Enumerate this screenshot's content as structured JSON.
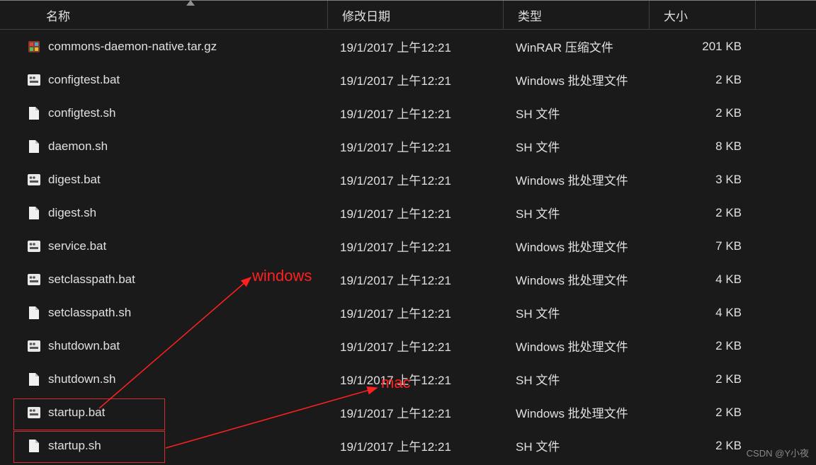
{
  "columns": {
    "name": "名称",
    "date": "修改日期",
    "type": "类型",
    "size": "大小"
  },
  "files": [
    {
      "name": "commons-daemon-native.tar.gz",
      "date": "19/1/2017 上午12:21",
      "type": "WinRAR 压缩文件",
      "size": "201 KB",
      "icon": "archive"
    },
    {
      "name": "configtest.bat",
      "date": "19/1/2017 上午12:21",
      "type": "Windows 批处理文件",
      "size": "2 KB",
      "icon": "bat"
    },
    {
      "name": "configtest.sh",
      "date": "19/1/2017 上午12:21",
      "type": "SH 文件",
      "size": "2 KB",
      "icon": "file"
    },
    {
      "name": "daemon.sh",
      "date": "19/1/2017 上午12:21",
      "type": "SH 文件",
      "size": "8 KB",
      "icon": "file"
    },
    {
      "name": "digest.bat",
      "date": "19/1/2017 上午12:21",
      "type": "Windows 批处理文件",
      "size": "3 KB",
      "icon": "bat"
    },
    {
      "name": "digest.sh",
      "date": "19/1/2017 上午12:21",
      "type": "SH 文件",
      "size": "2 KB",
      "icon": "file"
    },
    {
      "name": "service.bat",
      "date": "19/1/2017 上午12:21",
      "type": "Windows 批处理文件",
      "size": "7 KB",
      "icon": "bat"
    },
    {
      "name": "setclasspath.bat",
      "date": "19/1/2017 上午12:21",
      "type": "Windows 批处理文件",
      "size": "4 KB",
      "icon": "bat"
    },
    {
      "name": "setclasspath.sh",
      "date": "19/1/2017 上午12:21",
      "type": "SH 文件",
      "size": "4 KB",
      "icon": "file"
    },
    {
      "name": "shutdown.bat",
      "date": "19/1/2017 上午12:21",
      "type": "Windows 批处理文件",
      "size": "2 KB",
      "icon": "bat"
    },
    {
      "name": "shutdown.sh",
      "date": "19/1/2017 上午12:21",
      "type": "SH 文件",
      "size": "2 KB",
      "icon": "file"
    },
    {
      "name": "startup.bat",
      "date": "19/1/2017 上午12:21",
      "type": "Windows 批处理文件",
      "size": "2 KB",
      "icon": "bat"
    },
    {
      "name": "startup.sh",
      "date": "19/1/2017 上午12:21",
      "type": "SH 文件",
      "size": "2 KB",
      "icon": "file"
    }
  ],
  "annotations": {
    "windows": "windows",
    "mac": "mac"
  },
  "watermark": "CSDN @Y小夜"
}
